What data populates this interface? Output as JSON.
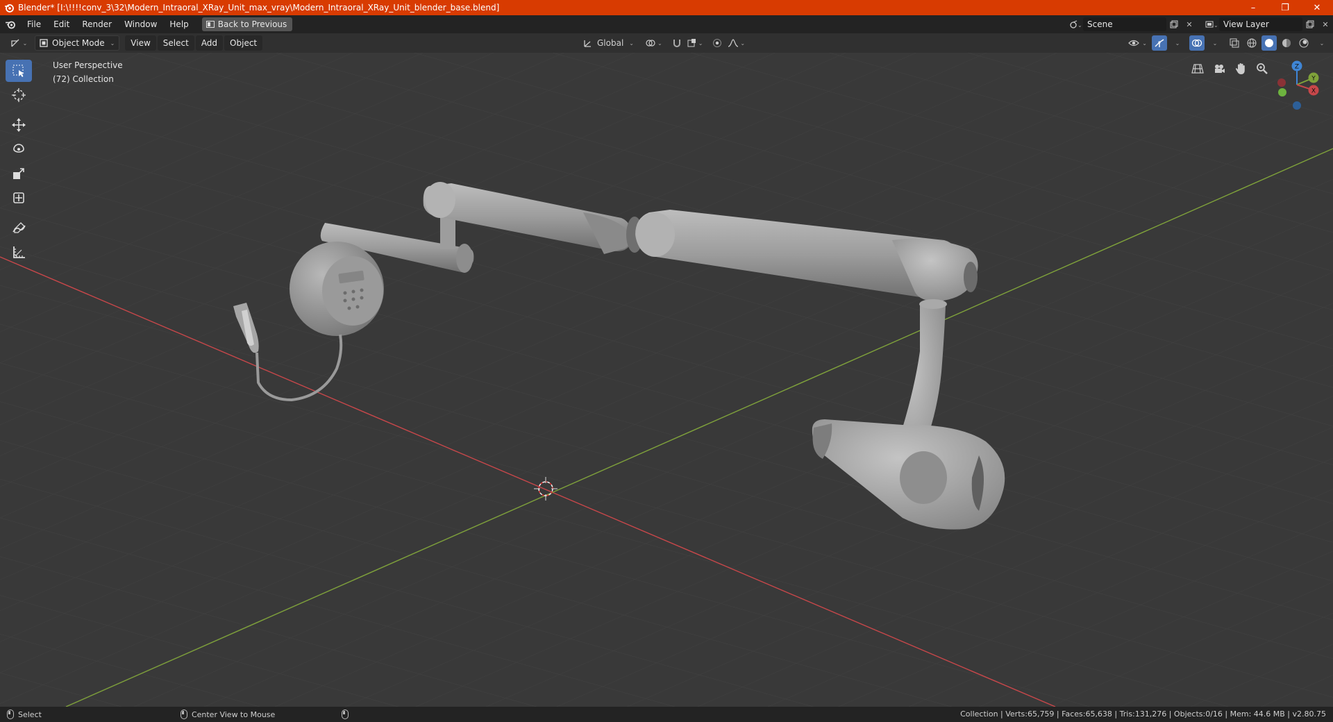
{
  "window": {
    "title": "Blender* [I:\\!!!!conv_3\\32\\Modern_Intraoral_XRay_Unit_max_vray\\Modern_Intraoral_XRay_Unit_blender_base.blend]",
    "minimize": "–",
    "restore": "❐",
    "close": "✕"
  },
  "menu": {
    "items": [
      "File",
      "Edit",
      "Render",
      "Window",
      "Help"
    ],
    "back_label": "Back to Previous"
  },
  "scene": {
    "scene_name": "Scene",
    "view_layer": "View Layer"
  },
  "viewport_header": {
    "mode": "Object Mode",
    "menus": [
      "View",
      "Select",
      "Add",
      "Object"
    ],
    "transform_orientation": "Global"
  },
  "viewport": {
    "perspective": "User Perspective",
    "collection": "(72) Collection"
  },
  "gizmo": {
    "z": "Z",
    "y": "Y",
    "x": "X"
  },
  "status": {
    "left_action": "Select",
    "middle_action": "Center View to Mouse",
    "stats": "Collection | Verts:65,759 | Faces:65,638 | Tris:131,276 | Objects:0/16 | Mem: 44.6 MB | v2.80.75"
  },
  "colors": {
    "titlebar": "#d83b01",
    "accent": "#4772b3",
    "x_axis": "#c7474a",
    "y_axis": "#7fa23a",
    "z_axis": "#3f86d6"
  }
}
